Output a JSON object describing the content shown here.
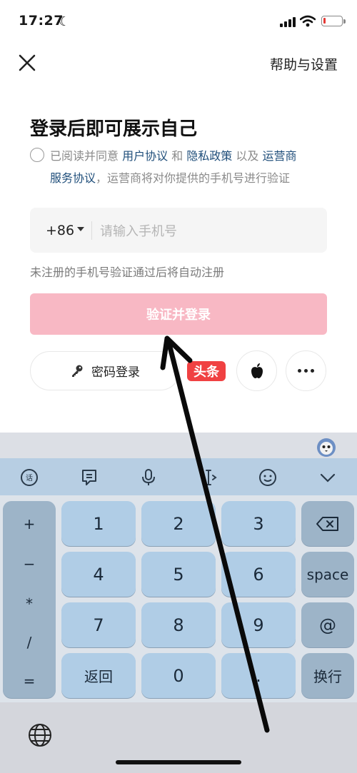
{
  "status_bar": {
    "time": "17:27"
  },
  "header": {
    "close_label": "✕",
    "help_link": "帮助与设置"
  },
  "page_title": "登录后即可展示自己",
  "agreement": {
    "prefix": "已阅读并同意 ",
    "user_agreement": "用户协议",
    "and": " 和 ",
    "privacy_policy": "隐私政策",
    "and2": " 以及 ",
    "carrier_a": "运营商",
    "carrier_b": "服务协议",
    "suffix": "，运营商将对你提供的手机号进行验证"
  },
  "phone": {
    "country_code": "+86",
    "placeholder": "请输入手机号"
  },
  "hint": "未注册的手机号验证通过后将自动注册",
  "login_button": "验证并登录",
  "alt_login": {
    "password_login": "密码登录",
    "toutiao_label": "头条"
  },
  "keyboard": {
    "symbols": [
      "+",
      "−",
      "*",
      "/",
      "="
    ],
    "keys": [
      "1",
      "2",
      "3",
      "4",
      "5",
      "6",
      "7",
      "8",
      "9",
      "返回",
      "0",
      "."
    ],
    "side_keys": [
      "space",
      "@",
      "换行"
    ]
  },
  "colors": {
    "login_button": "#f8b8c4",
    "link": "#1f4e7a",
    "toutiao": "#f04142",
    "keyboard_key": "#b0cde6"
  }
}
